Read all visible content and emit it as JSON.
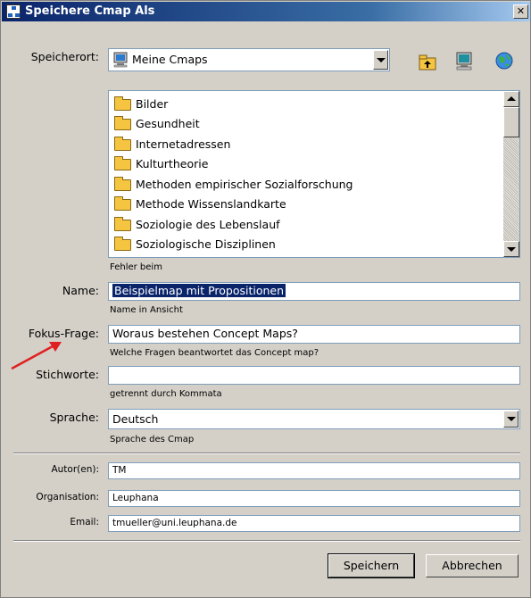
{
  "window": {
    "title": "Speichere Cmap Als"
  },
  "location": {
    "label": "Speicherort:",
    "selected": "Meine Cmaps"
  },
  "toolbar_icons": [
    "folder-up-icon",
    "computer-icon",
    "globe-icon"
  ],
  "folders": [
    "Bilder",
    "Gesundheit",
    "Internetadressen",
    "Kulturtheorie",
    "Methoden empirischer Sozialforschung",
    "Methode Wissenslandkarte",
    "Soziologie des Lebenslauf",
    "Soziologische Disziplinen"
  ],
  "list_status": "Fehler beim",
  "name": {
    "label": "Name:",
    "value": "Beispielmap mit Propositionen",
    "hint": "Name in Ansicht"
  },
  "focus": {
    "label": "Fokus-Frage:",
    "value": "Woraus bestehen Concept Maps?",
    "hint": "Welche Fragen beantwortet das Concept map?"
  },
  "keywords": {
    "label": "Stichworte:",
    "value": "",
    "hint": "getrennt durch Kommata"
  },
  "language": {
    "label": "Sprache:",
    "value": "Deutsch",
    "hint": "Sprache des Cmap"
  },
  "author": {
    "label": "Autor(en):",
    "value": "TM"
  },
  "organization": {
    "label": "Organisation:",
    "value": "Leuphana"
  },
  "email": {
    "label": "Email:",
    "value": "tmueller@uni.leuphana.de"
  },
  "buttons": {
    "save": "Speichern",
    "cancel": "Abbrechen"
  },
  "colors": {
    "annotation_arrow": "#e02020",
    "title_bar": "#0a246a",
    "dialog_bg": "#d4d0c8"
  }
}
